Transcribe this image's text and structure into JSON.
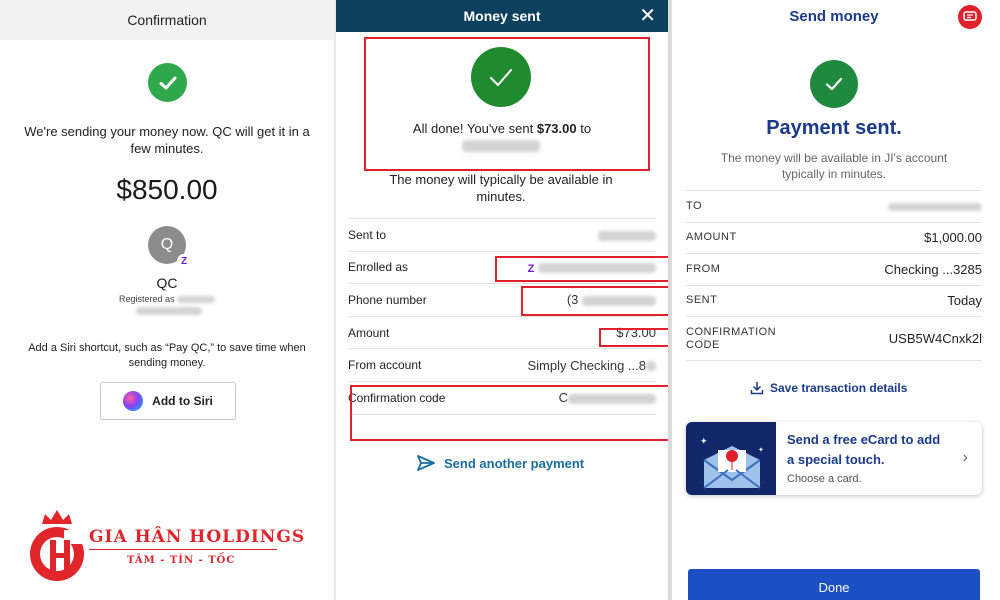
{
  "panel1": {
    "header_title": "Confirmation",
    "message": "We're sending your money now. QC will get it in a few minutes.",
    "amount": "$850.00",
    "avatar_initial": "Q",
    "zelle_glyph": "Z",
    "recipient_name": "QC",
    "registered_label": "Registered as",
    "siri_text": "Add a Siri shortcut, such as “Pay QC,” to save time when sending money.",
    "siri_button": "Add to Siri"
  },
  "logo": {
    "title": "GIA HÂN HOLDINGS",
    "subtitle": "TÂM - TÍN - TỐC"
  },
  "panel2": {
    "header_title": "Money sent",
    "close_glyph": "✕",
    "done_prefix": "All done! You've sent ",
    "done_amount": "$73.00",
    "done_suffix": " to",
    "typical_text": "The money will typically be available in minutes.",
    "rows": [
      {
        "label": "Sent to",
        "value": ""
      },
      {
        "label": "Enrolled as",
        "value": ""
      },
      {
        "label": "Phone number",
        "value": "(3"
      },
      {
        "label": "Amount",
        "value": "$73.00"
      },
      {
        "label": "From account",
        "value": "Simply Checking ...8"
      },
      {
        "label": "Confirmation code",
        "value": "C"
      }
    ],
    "send_another": "Send another payment"
  },
  "panel3": {
    "header_title": "Send money",
    "title": "Payment sent.",
    "subtitle": "The money will be available in JI's account typically in minutes.",
    "rows": [
      {
        "label": "TO",
        "value": ""
      },
      {
        "label": "AMOUNT",
        "value": "$1,000.00"
      },
      {
        "label": "FROM",
        "value": "Checking ...3285"
      },
      {
        "label": "SENT",
        "value": "Today"
      },
      {
        "label": "CONFIRMATION CODE",
        "value": "USB5W4Cnxk2l"
      }
    ],
    "save_details": "Save transaction details",
    "ecard_title": "Send a free eCard to add a special touch.",
    "ecard_sub": "Choose a card.",
    "done_button": "Done"
  },
  "colors": {
    "success_green": "#2ea84a",
    "money_sent_header": "#0d3f5f",
    "navy_text": "#1b3a8a",
    "done_blue": "#1b4fc4",
    "annotation_red": "#e0202a",
    "logo_red": "#e0252b"
  }
}
